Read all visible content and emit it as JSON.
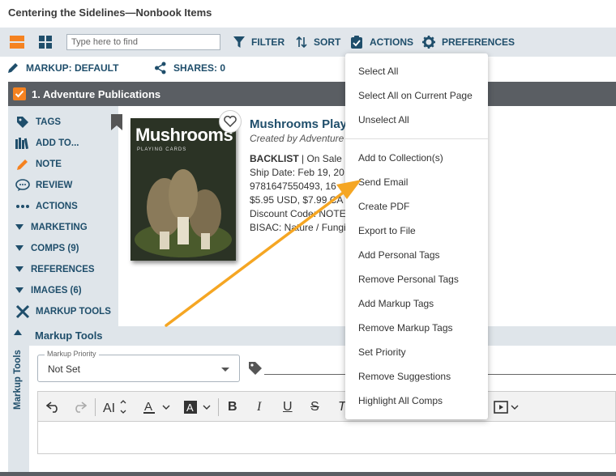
{
  "window": {
    "title": "Centering the Sidelines—Nonbook Items"
  },
  "toolbar": {
    "search_placeholder": "Type here to find",
    "filter_label": "FILTER",
    "sort_label": "SORT",
    "actions_label": "ACTIONS",
    "preferences_label": "PREFERENCES"
  },
  "markup_bar": {
    "markup_label": "MARKUP: DEFAULT",
    "shares_label": "SHARES: 0"
  },
  "item": {
    "header": "1. Adventure Publications",
    "cover_title": "Mushrooms",
    "cover_subtitle": "PLAYING CARDS",
    "title": "Mushrooms Play",
    "created_by": "Created by Adventure",
    "status": "BACKLIST",
    "status_suffix": " | On Sale D",
    "ship_date": "Ship Date: Feb 19, 20",
    "isbn": "9781647550493, 16",
    "price": "$5.95 USD, $7.99 CA",
    "discount": "Discount Code: NOTE",
    "bisac": "BISAC: Nature / Fungi"
  },
  "sidebar": {
    "items": [
      {
        "label": "TAGS",
        "icon": "tag-icon"
      },
      {
        "label": "ADD TO...",
        "icon": "books-icon"
      },
      {
        "label": "NOTE",
        "icon": "pencil-icon"
      },
      {
        "label": "REVIEW",
        "icon": "speech-bubble-icon"
      },
      {
        "label": "ACTIONS",
        "icon": "ellipsis-icon"
      },
      {
        "label": "MARKETING",
        "icon": "caret-down-icon"
      },
      {
        "label": "COMPS (9)",
        "icon": "caret-down-icon"
      },
      {
        "label": "REFERENCES",
        "icon": "caret-down-icon"
      },
      {
        "label": "IMAGES (6)",
        "icon": "caret-down-icon"
      },
      {
        "label": "MARKUP TOOLS",
        "icon": "tools-icon"
      }
    ]
  },
  "markup_tools": {
    "vertical_label": "Markup Tools",
    "panel_title": "Markup Tools",
    "priority_label": "Markup Priority",
    "priority_value": "Not Set"
  },
  "dropdown": {
    "items": [
      "Select All",
      "Select All on Current Page",
      "Unselect All",
      "Add to Collection(s)",
      "Send Email",
      "Create PDF",
      "Export to File",
      "Add Personal Tags",
      "Remove Personal Tags",
      "Add Markup Tags",
      "Remove Markup Tags",
      "Set Priority",
      "Remove Suggestions",
      "Highlight All Comps"
    ]
  },
  "colors": {
    "accent_orange": "#f58220",
    "brand_navy": "#1f4e6b",
    "toolbar_gray": "#e1e6eb",
    "header_dark": "#5a5e63",
    "annotation_arrow": "#f5a623"
  }
}
